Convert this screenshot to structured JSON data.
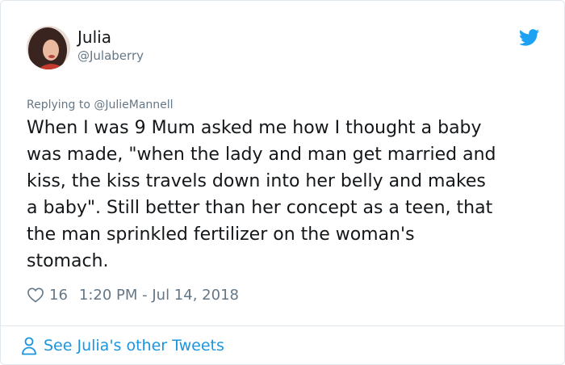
{
  "author": {
    "display_name": "Julia",
    "handle": "@Julaberry"
  },
  "reply": {
    "text": "Replying to @JulieMannell"
  },
  "tweet": {
    "text": "When I was 9 Mum asked me how I thought a baby\nwas made, \"when the lady and man get married and\nkiss, the kiss travels down into her belly and makes\na baby\". Still better than her concept as a teen, that\nthe man sprinkled fertilizer on the woman's\nstomach."
  },
  "meta": {
    "likes": "16",
    "timestamp": "1:20 PM - Jul 14, 2018"
  },
  "footer": {
    "link_text": "See Julia's other Tweets"
  },
  "icons": {
    "logo": "twitter-bird-icon",
    "like": "heart-icon",
    "profile": "person-icon"
  },
  "colors": {
    "brand": "#1da1f2",
    "link": "#1b95e0",
    "secondary_text": "#657786",
    "primary_text": "#14171a",
    "border": "#e1e8ed"
  }
}
